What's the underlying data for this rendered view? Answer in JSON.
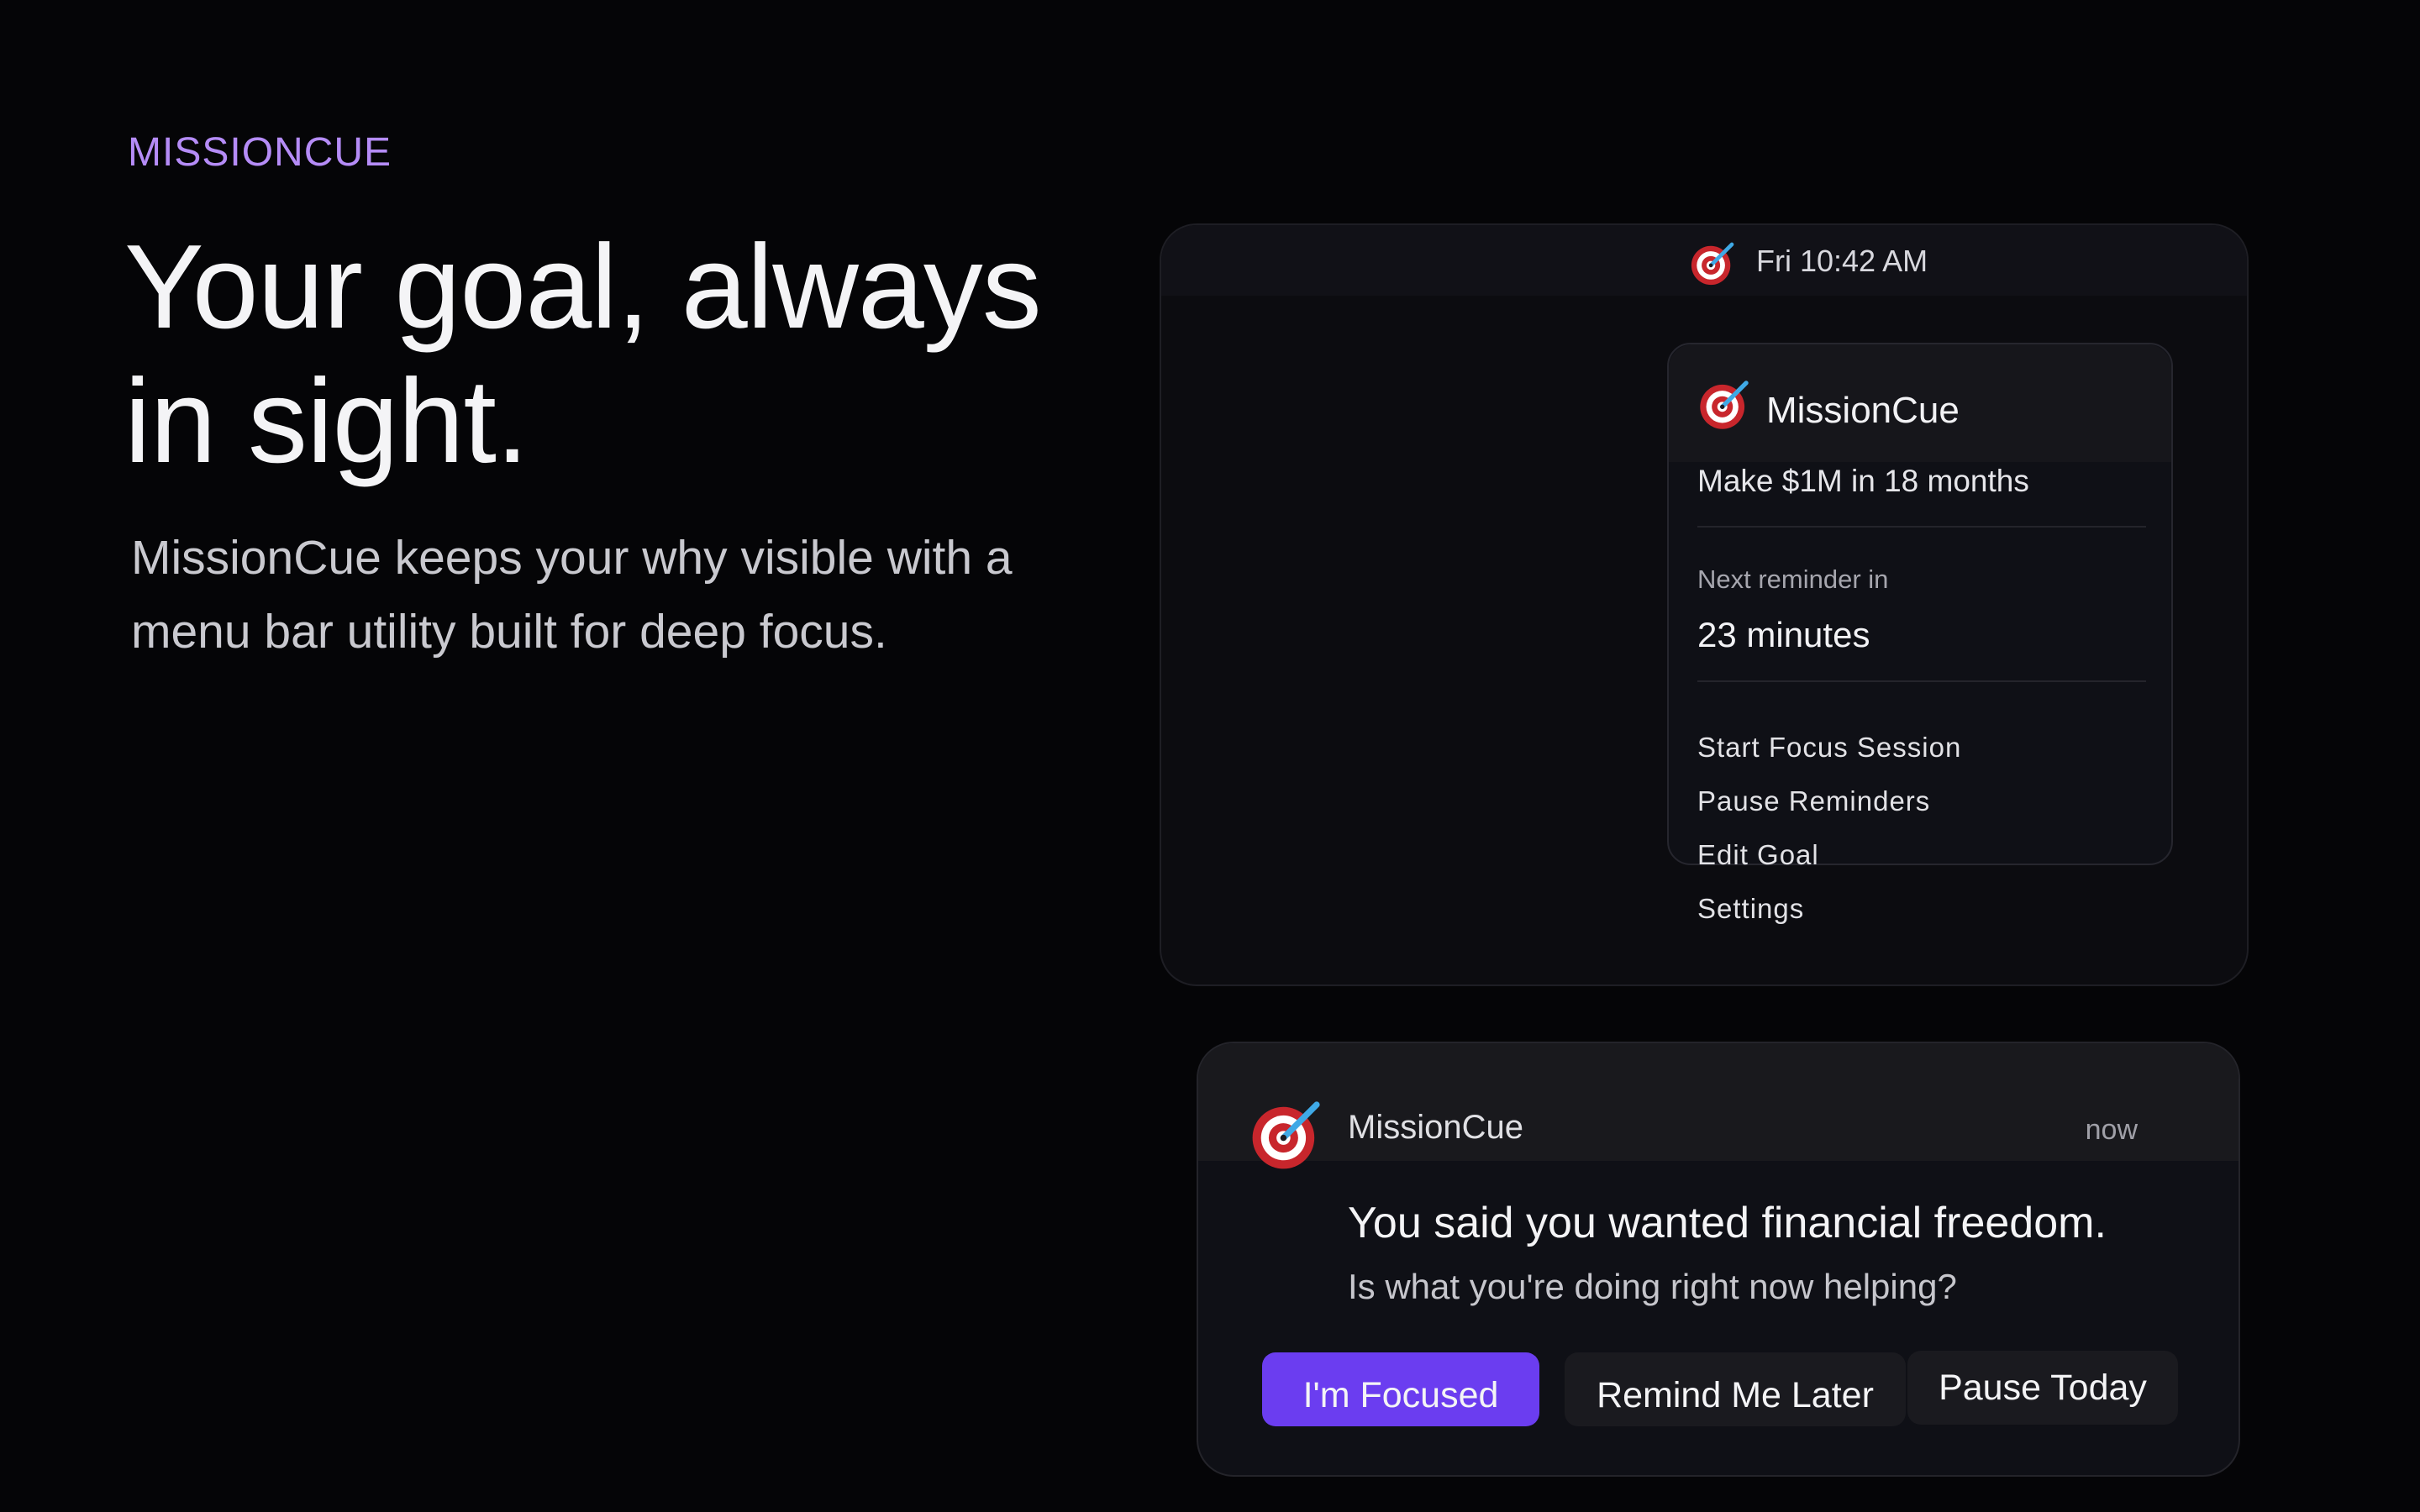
{
  "hero": {
    "eyebrow": "MISSIONCUE",
    "headline_line1": "Your goal, always",
    "headline_line2": "in sight.",
    "subhead_line1": "MissionCue keeps your why visible with a",
    "subhead_line2": "menu bar utility built for deep focus."
  },
  "menubar": {
    "clock": "Fri 10:42 AM",
    "icon": "target-icon"
  },
  "dropdown": {
    "app_name": "MissionCue",
    "goal": "Make $1M in 18 months",
    "next_reminder_label": "Next reminder in",
    "next_reminder_value": "23 minutes",
    "menu_items": [
      "Start Focus Session",
      "Pause Reminders",
      "Edit Goal",
      "Settings"
    ]
  },
  "notification": {
    "app_name": "MissionCue",
    "time": "now",
    "title": "You said you wanted financial freedom.",
    "body": "Is what you're doing right now helping?",
    "buttons": {
      "primary": "I'm Focused",
      "remind": "Remind Me Later",
      "pause": "Pause Today"
    }
  },
  "colors": {
    "background": "#050507",
    "accent": "#6b3df0",
    "eyebrow": "#b58cf7",
    "target_red": "#c8262c",
    "dart_blue": "#3fa9e6"
  }
}
